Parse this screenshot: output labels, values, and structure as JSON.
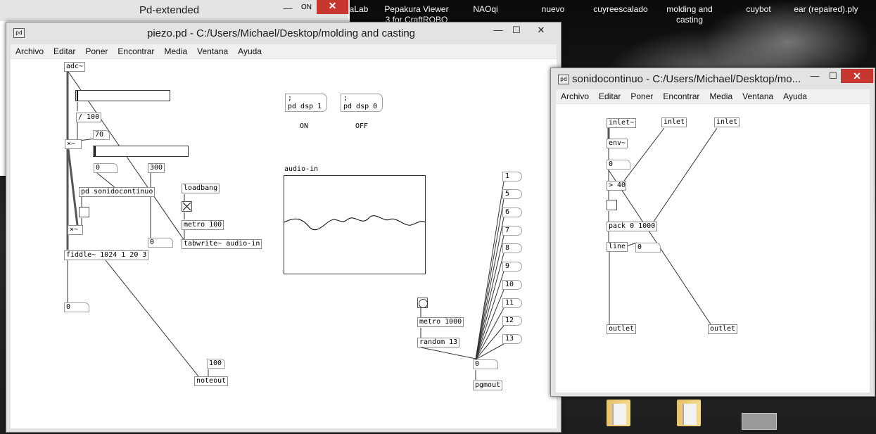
{
  "desktop": {
    "icons": [
      {
        "label": "aLab"
      },
      {
        "label": "Pepakura Viewer 3 for CraftROBO"
      },
      {
        "label": "NAOqi"
      },
      {
        "label": "nuevo"
      },
      {
        "label": "cuyreescalado"
      },
      {
        "label": "molding and casting"
      },
      {
        "label": "cuybot"
      },
      {
        "label": "ear (repaired).ply"
      }
    ]
  },
  "pd_main": {
    "title": "Pd-extended",
    "on_label": "ON",
    "off_label": "OFF"
  },
  "piezo": {
    "title": "piezo.pd  - C:/Users/Michael/Desktop/molding and casting",
    "menu": [
      "Archivo",
      "Editar",
      "Poner",
      "Encontrar",
      "Media",
      "Ventana",
      "Ayuda"
    ],
    "objects": {
      "adc": "adc~",
      "div100": "/ 100",
      "num70": "70",
      "mult1": "×~",
      "num0a": "0",
      "num300": "300",
      "sonido": "pd sonidocontinuo",
      "mult2": "×~",
      "fiddle": "fiddle~ 1024 1 20 3",
      "num0b": "0",
      "num0c": "0",
      "loadbang": "loadbang",
      "metro100": "metro 100",
      "tabwrite": "tabwrite~ audio-in",
      "dspon": ";\npd dsp 1",
      "dspoff": ";\npd dsp 0",
      "array_label": "audio-in",
      "num100": "100",
      "noteout": "noteout",
      "metro1000": "metro 1000",
      "random": "random 13",
      "numsel": "0",
      "pgmout": "pgmout",
      "msgs": [
        "1",
        "5",
        "6",
        "7",
        "8",
        "9",
        "10",
        "11",
        "12",
        "13"
      ]
    }
  },
  "sonido": {
    "title": "sonidocontinuo  - C:/Users/Michael/Desktop/mo...",
    "menu": [
      "Archivo",
      "Editar",
      "Poner",
      "Encontrar",
      "Media",
      "Ventana",
      "Ayuda"
    ],
    "objects": {
      "inlet_sig": "inlet~",
      "inlet1": "inlet",
      "inlet2": "inlet",
      "env": "env~",
      "num0": "0",
      "gt": "> 40",
      "pack": "pack 0 1000",
      "line": "line",
      "num0b": "0",
      "outlet1": "outlet",
      "outlet2": "outlet"
    }
  },
  "window_buttons": {
    "minimize": "—",
    "maximize": "☐",
    "close": "✕"
  }
}
